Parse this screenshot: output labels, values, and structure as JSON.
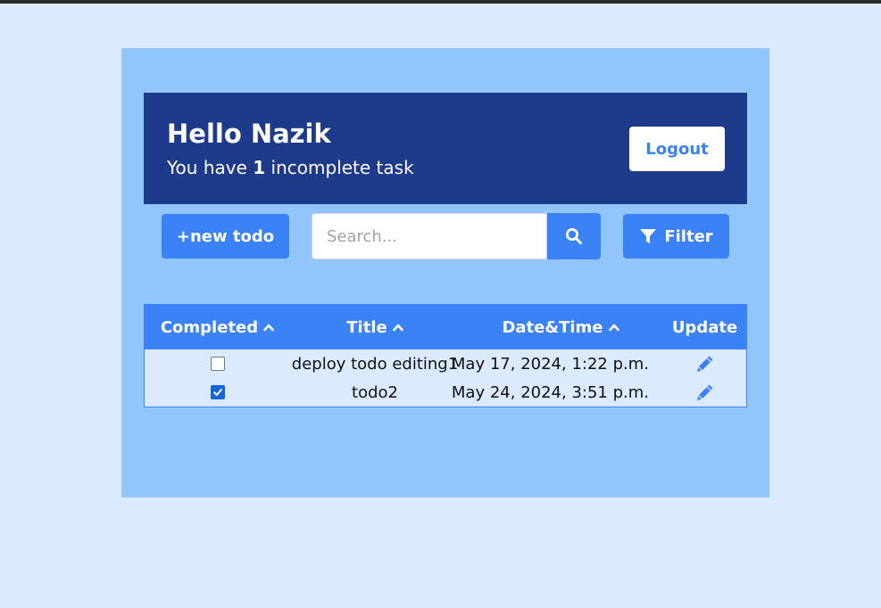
{
  "header": {
    "greeting": "Hello Nazik",
    "subtitle_prefix": "You have ",
    "incomplete_count": "1",
    "subtitle_suffix": " incomplete task",
    "logout_label": "Logout"
  },
  "toolbar": {
    "new_todo_label": "+new todo",
    "search_placeholder": "Search...",
    "filter_label": "Filter"
  },
  "table": {
    "columns": [
      "Completed",
      "Title",
      "Date&Time",
      "Update"
    ],
    "rows": [
      {
        "completed": false,
        "title": "deploy todo editing1",
        "datetime": "May 17, 2024, 1:22 p.m."
      },
      {
        "completed": true,
        "title": "todo2",
        "datetime": "May 24, 2024, 3:51 p.m."
      }
    ]
  },
  "colors": {
    "page_bg": "#dbeafe",
    "panel_bg": "#93c5fd",
    "header_bg": "#1e3a8a",
    "accent": "#3b82f6",
    "checkbox_checked": "#1565d8"
  },
  "icons": [
    "search-icon",
    "filter-icon",
    "chevron-up-icon",
    "pencil-icon"
  ]
}
